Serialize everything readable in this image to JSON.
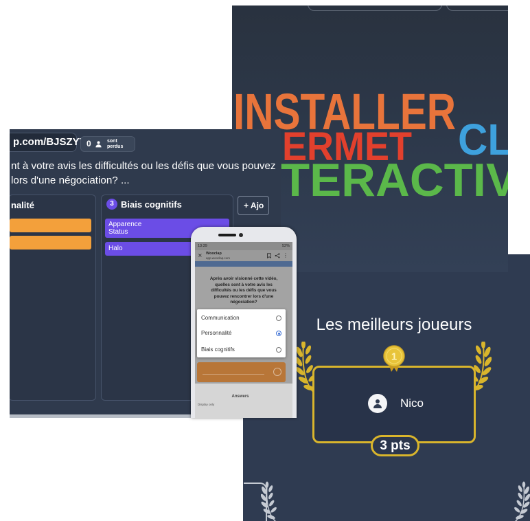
{
  "board": {
    "url": "p.com/BJSZYT",
    "lost_count": "0",
    "lost_icon": "person-icon",
    "lost_label": [
      "sont",
      "perdus"
    ],
    "question": [
      "nt à votre avis les difficultés ou les défis que vous pouvez",
      "lors d'une négociation? ..."
    ],
    "columns": [
      {
        "title": "nalité",
        "color": "#f3a03b"
      },
      {
        "number": "3",
        "title": "Biais cognitifs",
        "color": "#6b4de6",
        "cards": [
          {
            "lines": [
              "Apparence",
              "Status"
            ]
          },
          {
            "lines": [
              "Halo"
            ]
          }
        ]
      }
    ],
    "add_button": "+ Ajo"
  },
  "slide": {
    "words": [
      {
        "text": "INSTALLER",
        "color": "#e8743b"
      },
      {
        "text": "ERMET",
        "color": "#e2402d"
      },
      {
        "text": "CL",
        "color": "#3ea1dd"
      },
      {
        "text": "TERACTIV",
        "color": "#5bb84a"
      }
    ]
  },
  "phone": {
    "status_time": "13:39",
    "status_battery": "52%",
    "browser_title": "Wooclap",
    "browser_url": "app.wooclap.com",
    "question": [
      "Après avoir visionné cette vidéo,",
      "quelles sont à votre avis les",
      "difficultés ou les défis que vous",
      "pouvez rencontrer lors d'une",
      "négociation?"
    ],
    "options": [
      {
        "label": "Communication",
        "selected": false
      },
      {
        "label": "Personnalité",
        "selected": true
      },
      {
        "label": "Biais cognitifs",
        "selected": false
      }
    ],
    "answers_label": "Answers",
    "display_label": "Display only"
  },
  "leaderboard": {
    "title": "Les meilleurs joueurs",
    "rank": "1",
    "player": "Nico",
    "player_icon": "person-icon",
    "score": "3 pts",
    "accent": "#d9b52c",
    "silver": "#c5cad3"
  }
}
